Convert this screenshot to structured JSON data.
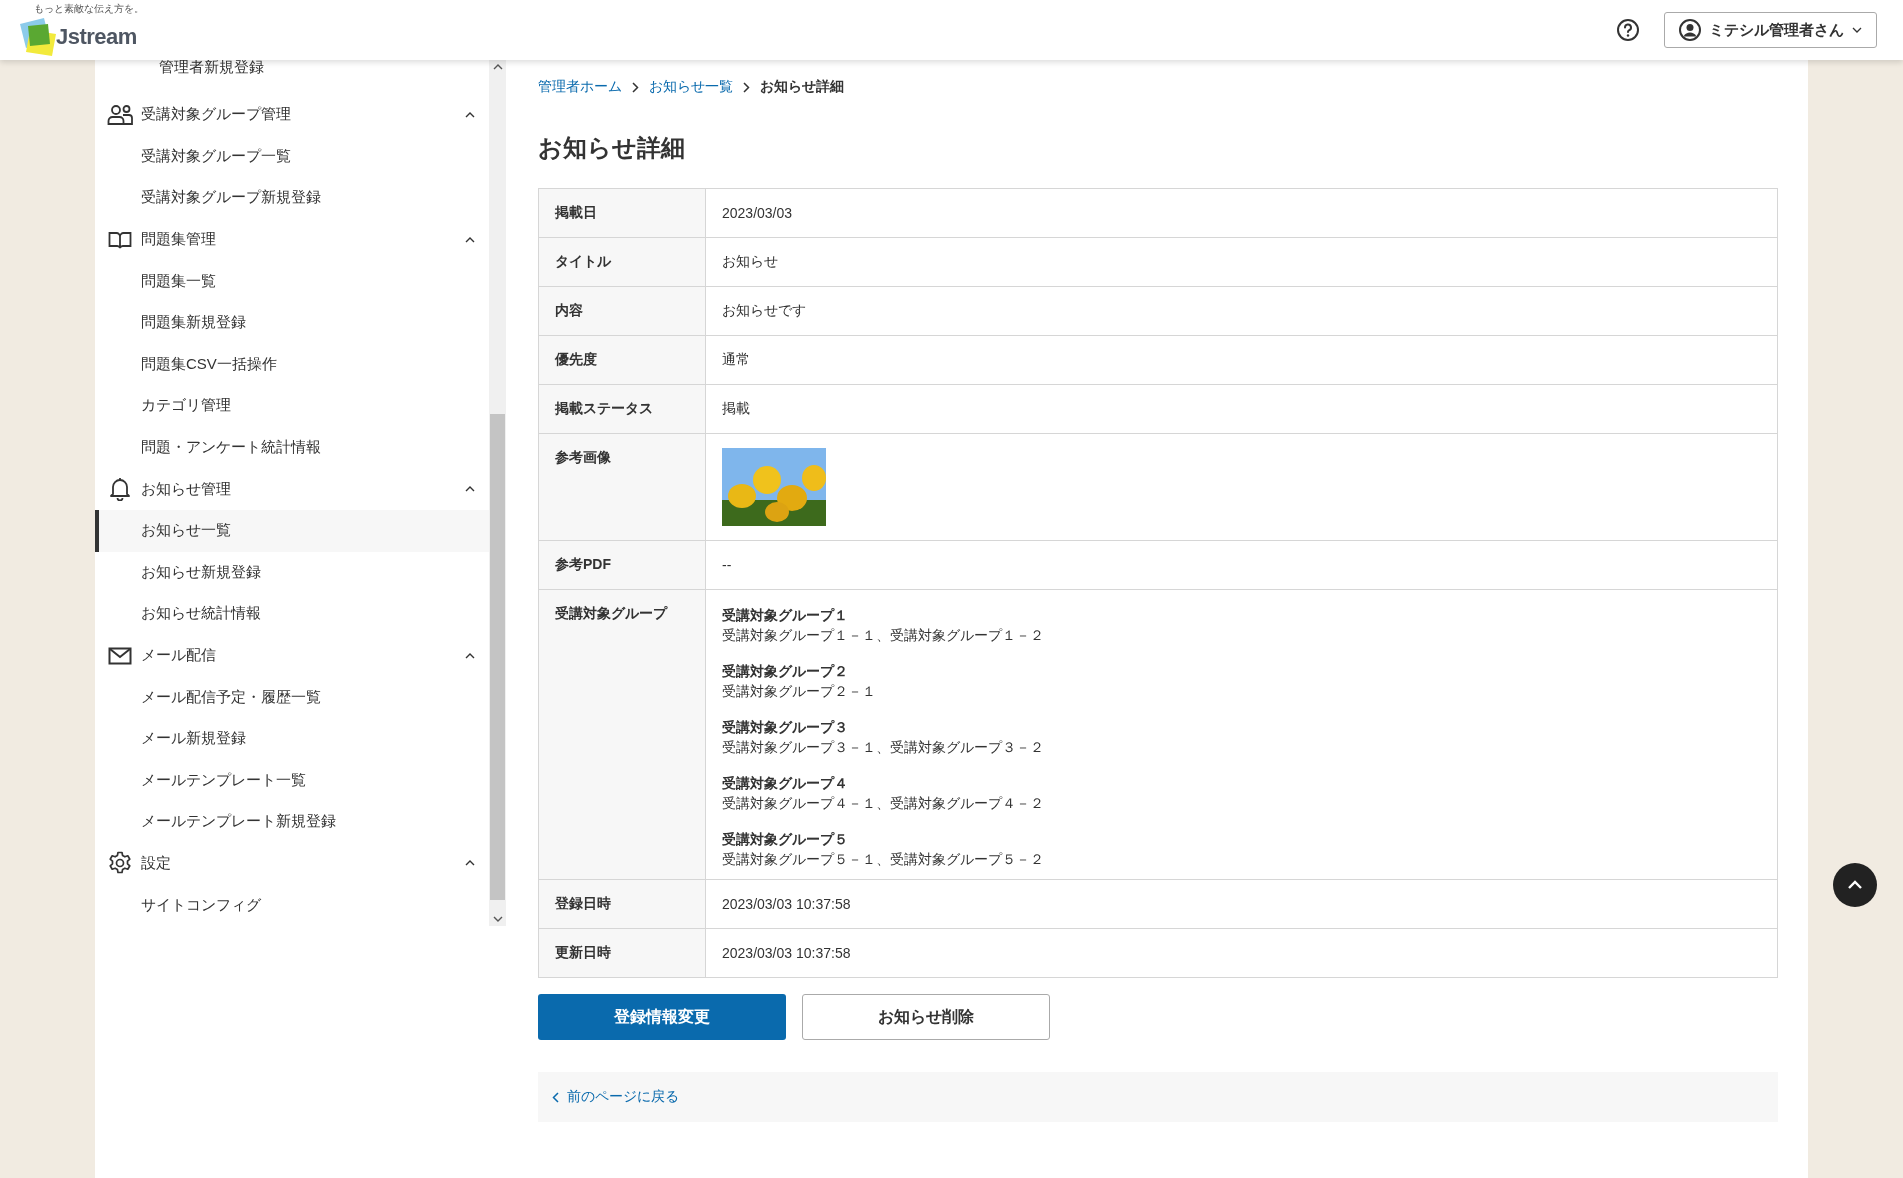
{
  "header": {
    "logo": {
      "tagline": "もっと素敵な伝え方を。",
      "wordmark": "Jstream"
    },
    "user_menu": {
      "name": "ミテシル管理者さん"
    }
  },
  "sidebar": {
    "top_item": {
      "label": "管理者新規登録",
      "selected": false
    },
    "sections": [
      {
        "title": "受講対象グループ管理",
        "kind": "people",
        "expanded": true,
        "items": [
          {
            "label": "受講対象グループ一覧",
            "selected": false
          },
          {
            "label": "受講対象グループ新規登録",
            "selected": false
          }
        ]
      },
      {
        "title": "問題集管理",
        "kind": "book",
        "expanded": true,
        "items": [
          {
            "label": "問題集一覧",
            "selected": false
          },
          {
            "label": "問題集新規登録",
            "selected": false
          },
          {
            "label": "問題集CSV一括操作",
            "selected": false
          },
          {
            "label": "カテゴリ管理",
            "selected": false
          },
          {
            "label": "問題・アンケート統計情報",
            "selected": false
          }
        ]
      },
      {
        "title": "お知らせ管理",
        "kind": "bell",
        "expanded": true,
        "items": [
          {
            "label": "お知らせ一覧",
            "selected": true
          },
          {
            "label": "お知らせ新規登録",
            "selected": false
          },
          {
            "label": "お知らせ統計情報",
            "selected": false
          }
        ]
      },
      {
        "title": "メール配信",
        "kind": "mail",
        "expanded": true,
        "items": [
          {
            "label": "メール配信予定・履歴一覧",
            "selected": false
          },
          {
            "label": "メール新規登録",
            "selected": false
          },
          {
            "label": "メールテンプレート一覧",
            "selected": false
          },
          {
            "label": "メールテンプレート新規登録",
            "selected": false
          }
        ]
      },
      {
        "title": "設定",
        "kind": "gear",
        "expanded": true,
        "items": [
          {
            "label": "サイトコンフィグ",
            "selected": false
          }
        ]
      }
    ]
  },
  "breadcrumb": {
    "links": [
      "管理者ホーム",
      "お知らせ一覧"
    ],
    "current": "お知らせ詳細"
  },
  "page_title": "お知らせ詳細",
  "detail_table": [
    {
      "label": "掲載日",
      "kind": "text",
      "value": "2023/03/03"
    },
    {
      "label": "タイトル",
      "kind": "text",
      "value": "お知らせ"
    },
    {
      "label": "内容",
      "kind": "text",
      "value": "お知らせです"
    },
    {
      "label": "優先度",
      "kind": "text",
      "value": "通常"
    },
    {
      "label": "掲載ステータス",
      "kind": "text",
      "value": "掲載"
    },
    {
      "label": "参考画像",
      "kind": "image"
    },
    {
      "label": "参考PDF",
      "kind": "text",
      "value": "--"
    },
    {
      "label": "受講対象グループ",
      "kind": "groups",
      "groups": [
        {
          "name": "受講対象グループ１",
          "members": "受講対象グループ１－１、受講対象グループ１－２"
        },
        {
          "name": "受講対象グループ２",
          "members": "受講対象グループ２－１"
        },
        {
          "name": "受講対象グループ３",
          "members": "受講対象グループ３－１、受講対象グループ３－２"
        },
        {
          "name": "受講対象グループ４",
          "members": "受講対象グループ４－１、受講対象グループ４－２"
        },
        {
          "name": "受講対象グループ５",
          "members": "受講対象グループ５－１、受講対象グループ５－２"
        }
      ]
    },
    {
      "label": "登録日時",
      "kind": "text",
      "value": "2023/03/03 10:37:58"
    },
    {
      "label": "更新日時",
      "kind": "text",
      "value": "2023/03/03 10:37:58"
    }
  ],
  "buttons": [
    {
      "label": "登録情報変更",
      "kind": "primary"
    },
    {
      "label": "お知らせ削除",
      "kind": "secondary"
    }
  ],
  "back_link": "前のページに戻る"
}
